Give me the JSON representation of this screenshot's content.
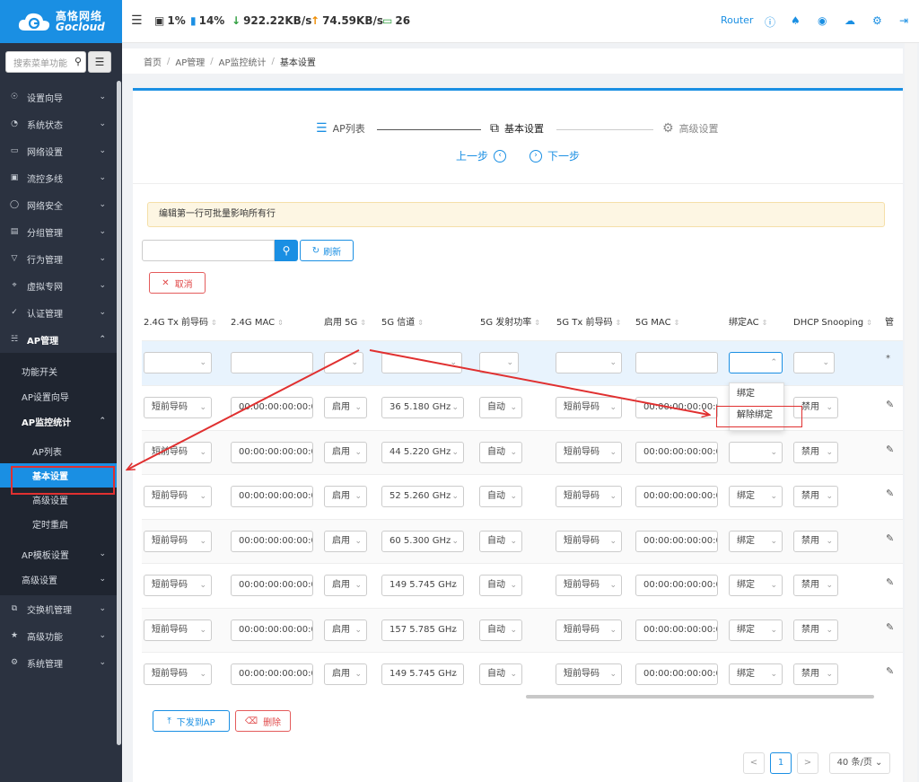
{
  "app": {
    "brand_cn": "高恪网络",
    "brand_en": "Gocloud"
  },
  "sidebar": {
    "search_placeholder": "搜索菜单功能",
    "items": [
      {
        "label": "设置向导",
        "icon": "compass-icon"
      },
      {
        "label": "系统状态",
        "icon": "dashboard-icon"
      },
      {
        "label": "网络设置",
        "icon": "monitor-icon"
      },
      {
        "label": "流控多线",
        "icon": "network-icon"
      },
      {
        "label": "网络安全",
        "icon": "shield-icon"
      },
      {
        "label": "分组管理",
        "icon": "list-icon"
      },
      {
        "label": "行为管理",
        "icon": "filter-icon"
      },
      {
        "label": "虚拟专网",
        "icon": "vpn-icon"
      },
      {
        "label": "认证管理",
        "icon": "check-shield-icon"
      },
      {
        "label": "AP管理",
        "icon": "sitemap-icon"
      }
    ],
    "ap_sub": [
      {
        "label": "功能开关"
      },
      {
        "label": "AP设置向导"
      },
      {
        "label": "AP监控统计"
      }
    ],
    "ap_monitor_sub": [
      {
        "label": "AP列表"
      },
      {
        "label": "基本设置"
      },
      {
        "label": "高级设置"
      },
      {
        "label": "定时重启"
      }
    ],
    "ap_sub_after": [
      {
        "label": "AP模板设置"
      },
      {
        "label": "高级设置"
      }
    ],
    "items_after": [
      {
        "label": "交换机管理",
        "icon": "switch-icon"
      },
      {
        "label": "高级功能",
        "icon": "pin-icon"
      },
      {
        "label": "系统管理",
        "icon": "gear-icon"
      }
    ]
  },
  "topbar": {
    "cpu": "1%",
    "mem": "14%",
    "down": "922.22KB/s",
    "up": "74.59KB/s",
    "clients": "26",
    "router_label": "Router"
  },
  "breadcrumb": [
    "首页",
    "AP管理",
    "AP监控统计",
    "基本设置"
  ],
  "steps": {
    "step1": "AP列表",
    "step2": "基本设置",
    "step3": "高级设置",
    "prev": "上一步",
    "next": "下一步"
  },
  "notice": "编辑第一行可批量影响所有行",
  "toolbar": {
    "refresh": "刷新",
    "cancel": "取消",
    "issue": "下发到AP",
    "delete": "删除"
  },
  "table": {
    "headers": [
      "2.4G Tx 前导码",
      "2.4G MAC",
      "启用 5G",
      "5G 信道",
      "5G 发射功率",
      "5G Tx 前导码",
      "5G MAC",
      "绑定AC",
      "DHCP Snooping",
      "管"
    ],
    "rows": [
      {
        "tx24": "短前导码",
        "mac24": "00:00:00:00:00:0",
        "en5g": "启用",
        "ch5g": "36 5.180 GHz",
        "pw5g": "自动",
        "tx5g": "短前导码",
        "mac5g": "00:00:00:00:00:0",
        "ac": "",
        "dhcp": "禁用"
      },
      {
        "tx24": "短前导码",
        "mac24": "00:00:00:00:00:0",
        "en5g": "启用",
        "ch5g": "44 5.220 GHz",
        "pw5g": "自动",
        "tx5g": "短前导码",
        "mac5g": "00:00:00:00:00:0",
        "ac": "",
        "dhcp": "禁用"
      },
      {
        "tx24": "短前导码",
        "mac24": "00:00:00:00:00:0",
        "en5g": "启用",
        "ch5g": "52 5.260 GHz",
        "pw5g": "自动",
        "tx5g": "短前导码",
        "mac5g": "00:00:00:00:00:0",
        "ac": "绑定",
        "dhcp": "禁用"
      },
      {
        "tx24": "短前导码",
        "mac24": "00:00:00:00:00:0",
        "en5g": "启用",
        "ch5g": "60 5.300 GHz",
        "pw5g": "自动",
        "tx5g": "短前导码",
        "mac5g": "00:00:00:00:00:0",
        "ac": "绑定",
        "dhcp": "禁用"
      },
      {
        "tx24": "短前导码",
        "mac24": "00:00:00:00:00:0",
        "en5g": "启用",
        "ch5g": "149 5.745 GHz",
        "pw5g": "自动",
        "tx5g": "短前导码",
        "mac5g": "00:00:00:00:00:0",
        "ac": "绑定",
        "dhcp": "禁用"
      },
      {
        "tx24": "短前导码",
        "mac24": "00:00:00:00:00:0",
        "en5g": "启用",
        "ch5g": "157 5.785 GHz",
        "pw5g": "自动",
        "tx5g": "短前导码",
        "mac5g": "00:00:00:00:00:0",
        "ac": "绑定",
        "dhcp": "禁用"
      },
      {
        "tx24": "短前导码",
        "mac24": "00:00:00:00:00:0",
        "en5g": "启用",
        "ch5g": "149 5.745 GHz",
        "pw5g": "自动",
        "tx5g": "短前导码",
        "mac5g": "00:00:00:00:00:0",
        "ac": "绑定",
        "dhcp": "禁用"
      }
    ],
    "edit_row_marker": "*",
    "dropdown_options": [
      "绑定",
      "解除绑定"
    ]
  },
  "pagination": {
    "current": "1",
    "prev": "<",
    "next": ">",
    "page_size": "40 条/页"
  },
  "colors": {
    "accent": "#1a8fe3",
    "sidebar_bg": "#2b3240",
    "danger": "#e04848",
    "annotation": "#e03030"
  }
}
